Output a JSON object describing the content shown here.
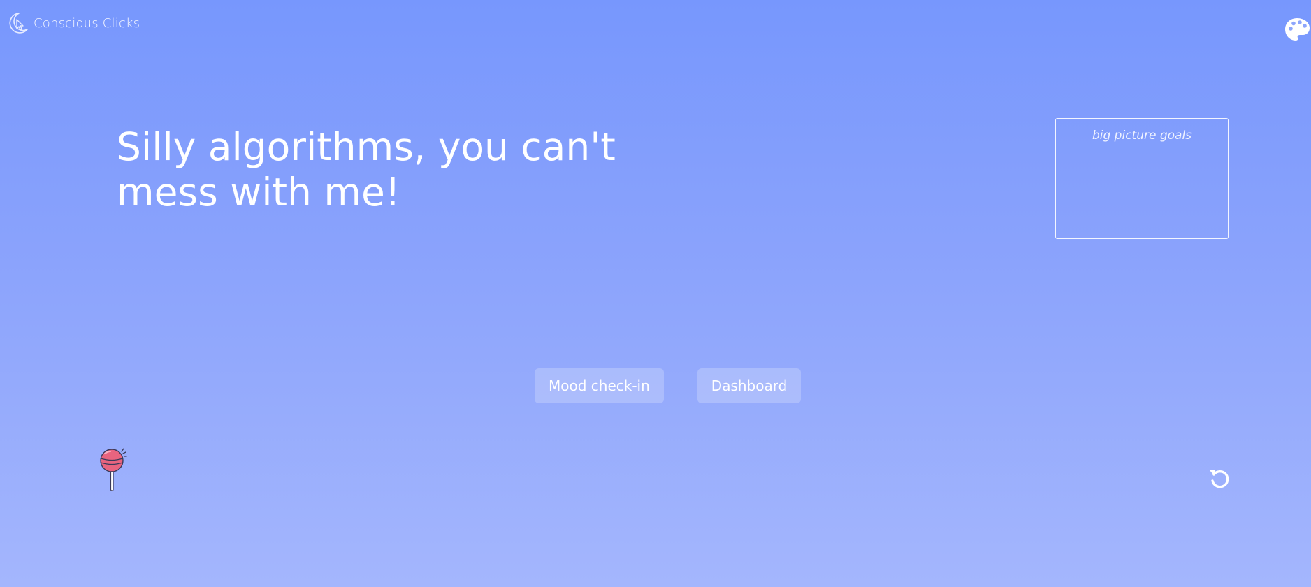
{
  "brand": {
    "name": "Conscious Clicks",
    "icon": "moon-cursor-logo-icon"
  },
  "header": {
    "palette_icon": "palette-icon"
  },
  "main": {
    "headline": "Silly algorithms, you can't mess with me!"
  },
  "goals": {
    "placeholder": "big picture goals",
    "value": ""
  },
  "actions": {
    "mood_checkin_label": "Mood check-in",
    "dashboard_label": "Dashboard"
  },
  "footer": {
    "treat_icon": "lollipop-icon",
    "reset_icon": "undo-icon"
  },
  "colors": {
    "background_top": "#7797fd",
    "background_bottom": "#a4b6fd",
    "text": "#ffffff",
    "lollipop": "#e8647f"
  }
}
